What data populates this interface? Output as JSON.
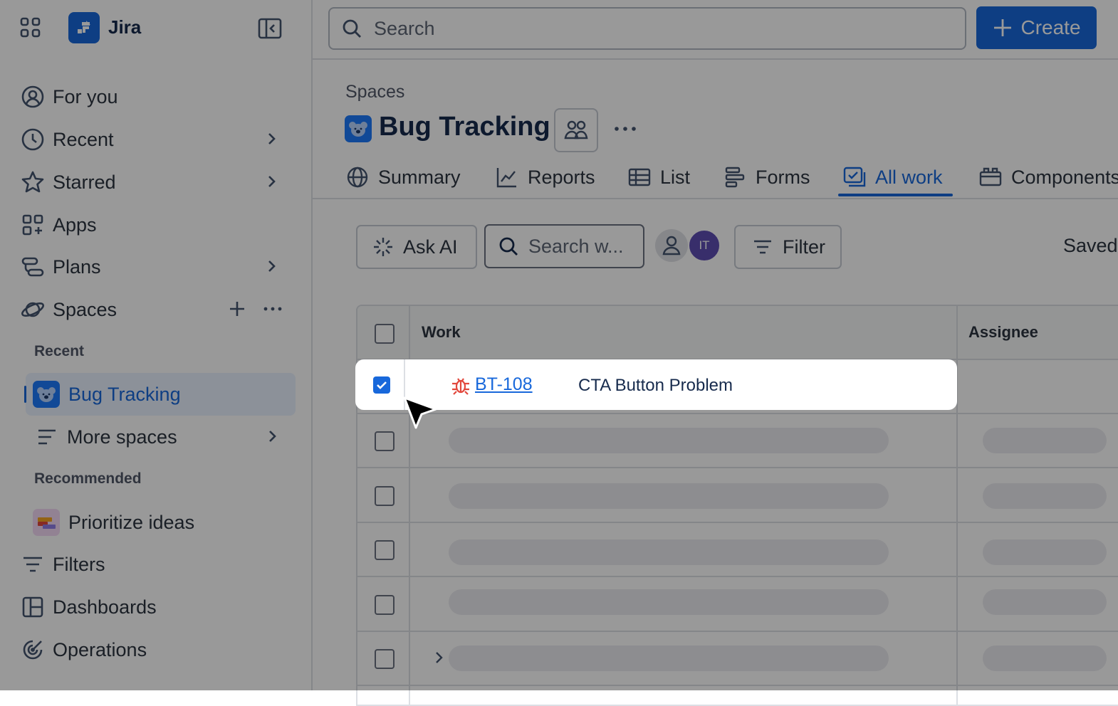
{
  "app": {
    "name": "Jira"
  },
  "sidebar": {
    "nav": [
      {
        "label": "For you",
        "icon": "user-circle-icon"
      },
      {
        "label": "Recent",
        "icon": "clock-icon"
      },
      {
        "label": "Starred",
        "icon": "star-icon"
      },
      {
        "label": "Apps",
        "icon": "apps-icon"
      },
      {
        "label": "Plans",
        "icon": "plans-icon"
      },
      {
        "label": "Spaces",
        "icon": "planet-icon"
      }
    ],
    "spaces_recent_label": "Recent",
    "spaces_recent": [
      {
        "label": "Bug Tracking"
      }
    ],
    "more_spaces": "More spaces",
    "recommended_label": "Recommended",
    "recommended": [
      {
        "label": "Prioritize ideas"
      }
    ],
    "bottom_nav": [
      {
        "label": "Filters",
        "icon": "filter-icon"
      },
      {
        "label": "Dashboards",
        "icon": "dashboard-icon"
      },
      {
        "label": "Operations",
        "icon": "operations-icon"
      }
    ]
  },
  "topbar": {
    "search_placeholder": "Search",
    "create_label": "Create"
  },
  "page": {
    "breadcrumb": "Spaces",
    "title": "Bug Tracking",
    "tabs": [
      {
        "label": "Summary",
        "icon": "globe-icon"
      },
      {
        "label": "Reports",
        "icon": "chart-line-icon"
      },
      {
        "label": "List",
        "icon": "table-icon"
      },
      {
        "label": "Forms",
        "icon": "forms-icon"
      },
      {
        "label": "All work",
        "icon": "all-work-icon",
        "active": true
      },
      {
        "label": "Components",
        "icon": "components-icon"
      }
    ]
  },
  "toolbar": {
    "ask_ai": "Ask AI",
    "search_placeholder": "Search w...",
    "avatar_initials": "IT",
    "filter": "Filter",
    "saved": "Saved"
  },
  "table": {
    "columns": [
      "Work",
      "Assignee"
    ],
    "highlighted_row": {
      "key": "BT-108",
      "summary": "CTA Button Problem",
      "checked": true,
      "type_icon": "bug-icon"
    }
  },
  "colors": {
    "accent": "#1868db",
    "bug": "#e2483d",
    "avatar": "#5e4db2"
  }
}
